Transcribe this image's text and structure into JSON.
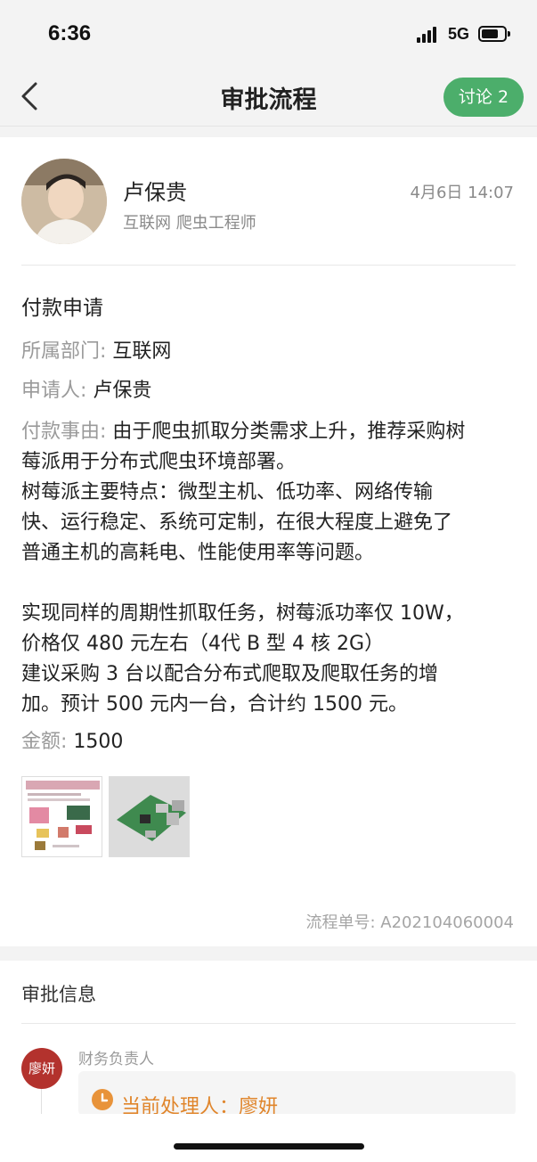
{
  "status_bar": {
    "time": "6:36",
    "network": "5G"
  },
  "nav": {
    "title": "审批流程",
    "discuss_label": "讨论 2",
    "back_icon": "chevron-left-icon"
  },
  "applicant": {
    "name": "卢保贵",
    "role": "互联网 爬虫工程师",
    "time": "4月6日 14:07"
  },
  "form": {
    "title": "付款申请",
    "department_label": "所属部门:",
    "department_value": "互联网",
    "applicant_label": "申请人:",
    "applicant_value": "卢保贵",
    "reason_label": "付款事由:",
    "reason_lines": [
      "由于爬虫抓取分类需求上升，推荐采购树",
      "莓派用于分布式爬虫环境部署。",
      "树莓派主要特点：微型主机、低功率、网络传输",
      "快、运行稳定、系统可定制，在很大程度上避免了",
      "普通主机的高耗电、性能使用率等问题。",
      "",
      "实现同样的周期性抓取任务，树莓派功率仅 10W，",
      "价格仅 480 元左右（4代 B 型 4 核 2G）",
      "建议采购 3 台以配合分布式爬取及爬取任务的增",
      "加。预计 500 元内一台，合计约 1500 元。"
    ],
    "amount_label": "金额:",
    "amount_value": "1500",
    "flow_number": "流程单号: A202104060004"
  },
  "approval": {
    "section_title": "审批信息",
    "step_role": "财务负责人",
    "step_avatar_text": "廖妍",
    "handler_text": "当前处理人：廖妍"
  },
  "colors": {
    "accent_green": "#4cae6b",
    "avatar_red": "#b3322d",
    "handler_orange": "#e0852b"
  }
}
